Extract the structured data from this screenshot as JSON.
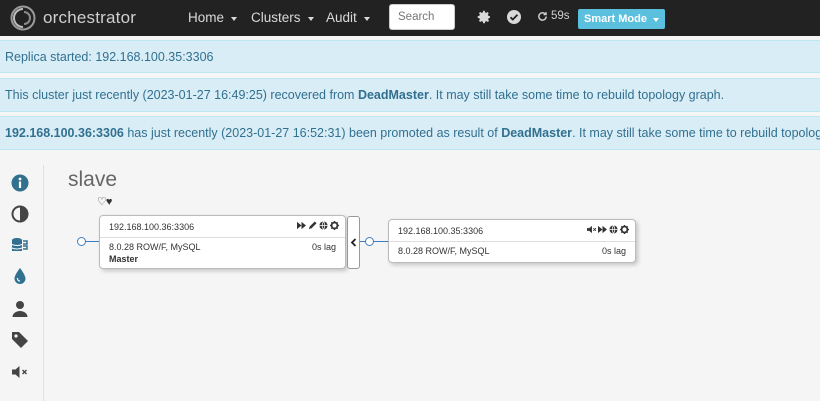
{
  "navbar": {
    "brand": "orchestrator",
    "menu": [
      {
        "label": "Home"
      },
      {
        "label": "Clusters"
      },
      {
        "label": "Audit"
      }
    ],
    "search_placeholder": "Search",
    "timer": "59s",
    "mode_button": "Smart Mode"
  },
  "alerts": [
    {
      "text": "Replica started: 192.168.100.35:3306"
    },
    {
      "text_before": "This cluster just recently (2023-01-27 16:49:25) recovered from ",
      "bold": "DeadMaster",
      "text_after": ". It may still take some time to rebuild topology graph."
    },
    {
      "bold_lead": "192.168.100.36:3306",
      "text_before": " has just recently (2023-01-27 16:52:31) been promoted as result of ",
      "bold": "DeadMaster",
      "text_after": ". It may still take some time to rebuild topology graph."
    }
  ],
  "cluster": {
    "title": "slave",
    "hearts": "♡♥"
  },
  "instances": [
    {
      "host": "192.168.100.36:3306",
      "version": "8.0.28 ROW/F, MySQL",
      "lag": "0s lag",
      "role": "Master"
    },
    {
      "host": "192.168.100.35:3306",
      "version": "8.0.28 ROW/F, MySQL",
      "lag": "0s lag",
      "role": ""
    }
  ],
  "icons": {
    "sidebar": [
      "info-icon",
      "contrast-icon",
      "database-icon",
      "droplet-icon",
      "user-icon",
      "tag-icon",
      "mute-icon"
    ],
    "accent": "#31708f",
    "link_blue": "#3c7dc4"
  }
}
